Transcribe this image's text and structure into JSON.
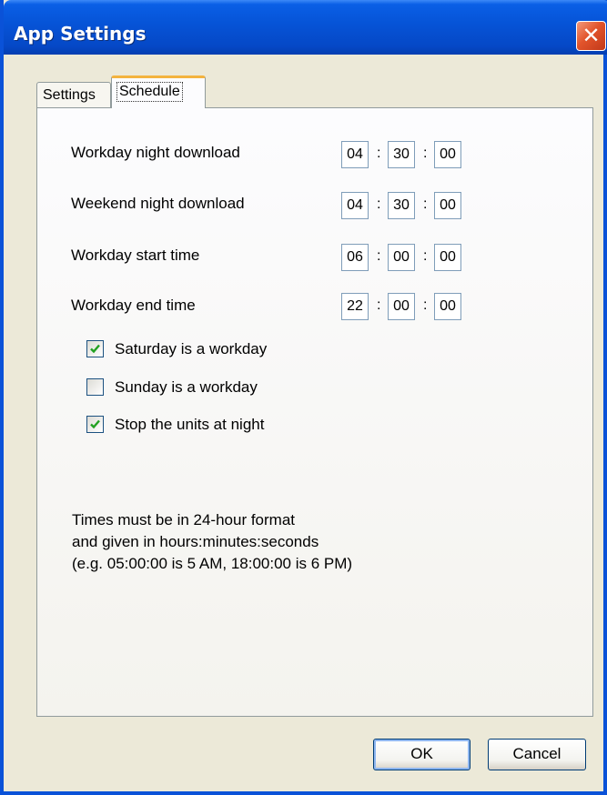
{
  "window": {
    "title": "App Settings",
    "close_symbol": "✕"
  },
  "tabs": [
    {
      "label": "Settings",
      "active": false
    },
    {
      "label": "Schedule",
      "active": true
    }
  ],
  "schedule": {
    "rows": [
      {
        "label": "Workday night download",
        "h": "04",
        "m": "30",
        "s": "00"
      },
      {
        "label": "Weekend night download",
        "h": "04",
        "m": "30",
        "s": "00"
      },
      {
        "label": "Workday start time",
        "h": "06",
        "m": "00",
        "s": "00"
      },
      {
        "label": "Workday end time",
        "h": "22",
        "m": "00",
        "s": "00"
      }
    ],
    "separator": ":",
    "checkboxes": [
      {
        "label": "Saturday is a workday",
        "checked": true
      },
      {
        "label": "Sunday is a workday",
        "checked": false
      },
      {
        "label": "Stop the units at night",
        "checked": true
      }
    ],
    "note_lines": [
      "Times must be in 24-hour format",
      "and given in hours:minutes:seconds",
      "(e.g. 05:00:00 is 5 AM, 18:00:00 is 6 PM)"
    ]
  },
  "buttons": {
    "ok": "OK",
    "cancel": "Cancel"
  },
  "colors": {
    "titlebar": "#0653d6",
    "close": "#e2542b",
    "check": "#21a121",
    "dialog_bg": "#ece9d8"
  },
  "icons": {
    "close": "close-icon",
    "check": "checkmark-icon"
  }
}
